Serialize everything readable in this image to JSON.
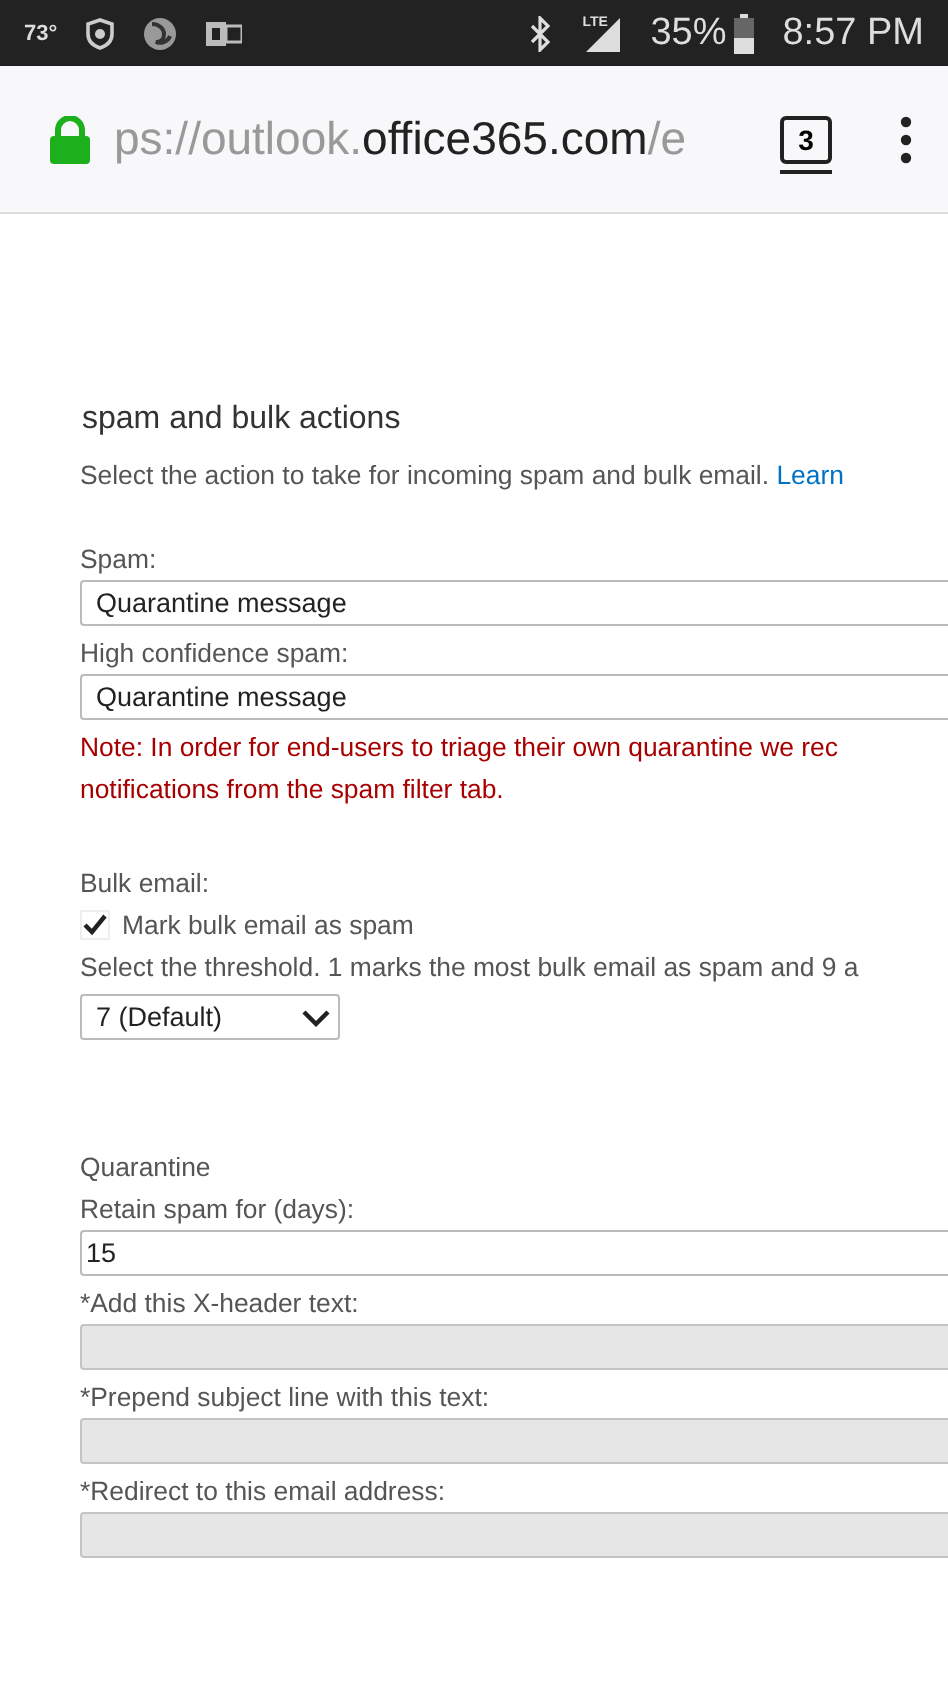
{
  "status_bar": {
    "temperature": "73°",
    "battery_percent": "35%",
    "time": "8:57 PM",
    "network": "LTE"
  },
  "address_bar": {
    "url": {
      "prefix": "ps://outlook.",
      "domain": "office365.com",
      "suffix": "/e"
    },
    "tab_count": "3"
  },
  "section": {
    "title": "spam and bulk actions",
    "description": "Select the action to take for incoming spam and bulk email.",
    "link": "Learn",
    "fields": [
      {
        "kind": "select",
        "label": "Spam:",
        "value": "Quarantine message"
      },
      {
        "kind": "select",
        "label": "High confidence spam:",
        "value": "Quarantine message"
      },
      {
        "kind": "note",
        "lines": [
          "Note: In order for end-users to triage their own quarantine we rec",
          "notifications from the spam filter tab."
        ]
      },
      {
        "kind": "heading",
        "label": "Bulk email:"
      },
      {
        "kind": "checkbox",
        "label": "Mark bulk email as spam",
        "checked": true
      },
      {
        "kind": "text",
        "label": "Select the threshold. 1 marks the most bulk email as spam and 9 a"
      },
      {
        "kind": "dropdown",
        "value": "7 (Default)"
      },
      {
        "kind": "heading",
        "label": "Quarantine"
      },
      {
        "kind": "input",
        "label": "Retain spam for (days):",
        "value": "15",
        "disabled": false
      },
      {
        "kind": "input",
        "label": "*Add this X-header text:",
        "disabled": true
      },
      {
        "kind": "input",
        "label": "*Prepend subject line with this text:",
        "disabled": true
      },
      {
        "kind": "input",
        "label": "*Redirect to this email address:",
        "disabled": true
      }
    ]
  }
}
